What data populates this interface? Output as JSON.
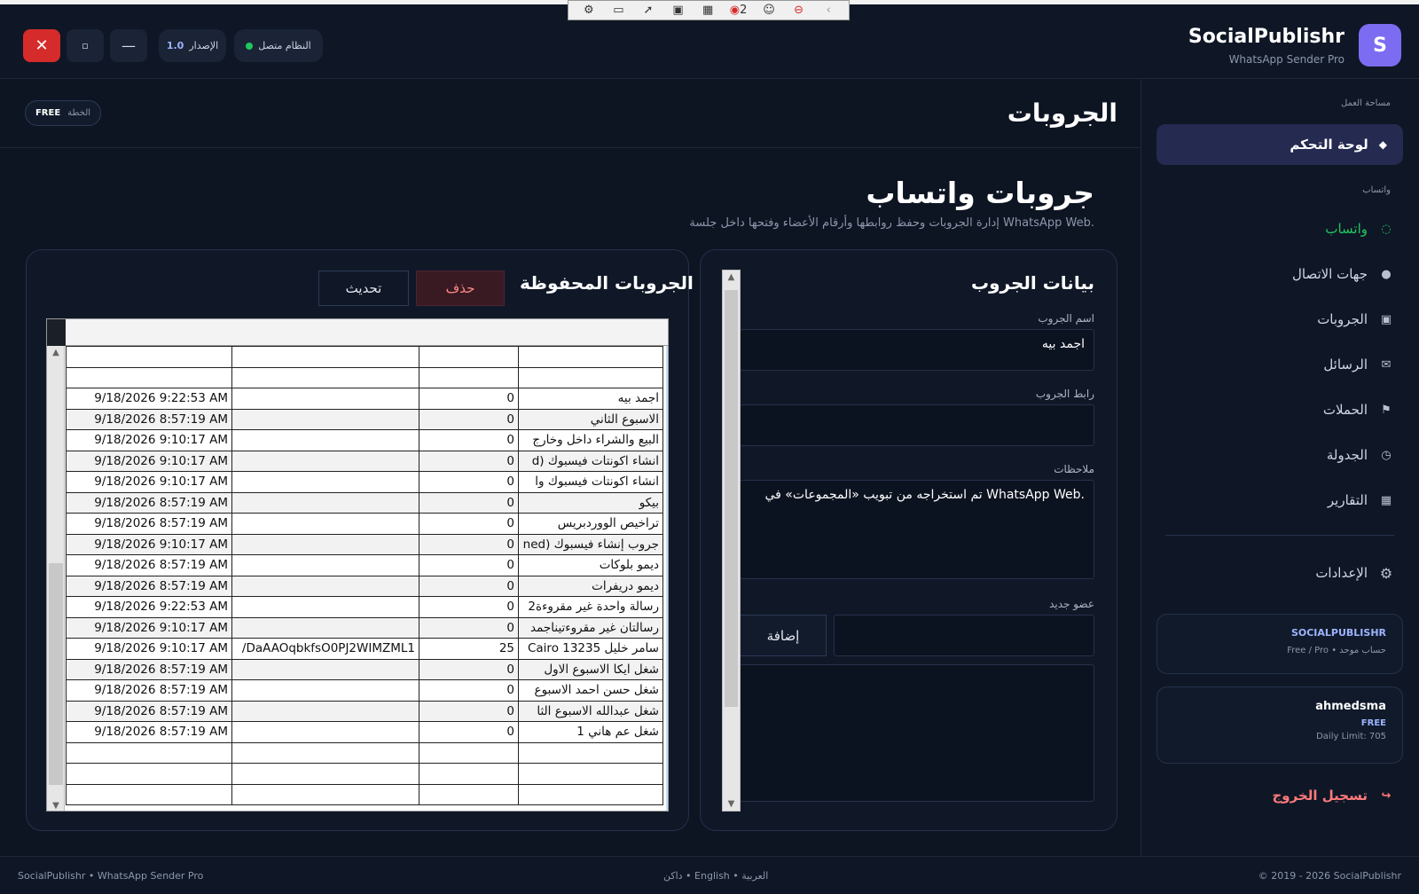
{
  "app": {
    "brand_title": "SocialPublishr",
    "brand_sub": "WhatsApp Sender Pro",
    "logo_letter": "S",
    "status_text": "النظام متصل",
    "version_label": "الإصدار",
    "version_value": "1.0",
    "plan_label": "الخطة",
    "plan_value": "FREE",
    "accent": "#7c6cf2",
    "whatsapp_green": "#22c55e",
    "danger": "#d62b2b"
  },
  "capture_toolbar": {
    "counter": "2"
  },
  "sidebar": {
    "section_workspace": "مساحة العمل",
    "dashboard": "لوحة التحكم",
    "section_whatsapp": "واتساب",
    "items": [
      {
        "label": "واتساب",
        "icon": "chat-bubble-icon"
      },
      {
        "label": "جهات الاتصال",
        "icon": "contacts-icon"
      },
      {
        "label": "الجروبات",
        "icon": "groups-icon"
      },
      {
        "label": "الرسائل",
        "icon": "envelope-icon"
      },
      {
        "label": "الحملات",
        "icon": "flag-icon"
      },
      {
        "label": "الجدولة",
        "icon": "clock-icon"
      },
      {
        "label": "التقارير",
        "icon": "report-icon"
      }
    ],
    "settings": "الإعدادات",
    "account_card": {
      "title": "SOCIALPUBLISHR",
      "sub": "Free / Pro • حساب موحد"
    },
    "user_card": {
      "name": "ahmedsma",
      "plan": "FREE",
      "limit": "Daily Limit: 705"
    },
    "logout": "تسجيل الخروج"
  },
  "header": {
    "title": "الجروبات"
  },
  "section": {
    "title": "جروبات واتساب",
    "subtitle": "إدارة الجروبات وحفظ روابطها وأرقام الأعضاء وفتحها داخل جلسة WhatsApp Web."
  },
  "form": {
    "title": "بيانات الجروب",
    "name_label": "اسم الجروب",
    "name_value": "اجمد بيه",
    "link_label": "رابط الجروب",
    "link_value": "",
    "notes_label": "ملاحظات",
    "notes_value": "تم استخراجه من تبويب «المجموعات» في WhatsApp Web.",
    "member_label": "عضو جديد",
    "member_value": "",
    "add_button": "إضافة"
  },
  "saved": {
    "title": "الجروبات المحفوظة",
    "delete_button": "حذف",
    "refresh_button": "تحديث",
    "rows": [
      {
        "name": "اجمد بيه",
        "members": "0",
        "link": "",
        "updated": "9/18/2026 9:22:53 AM"
      },
      {
        "name": "الاسبوع الثاني",
        "members": "0",
        "link": "",
        "updated": "9/18/2026 8:57:19 AM"
      },
      {
        "name": "البيع والشراء داخل وخارج",
        "members": "0",
        "link": "",
        "updated": "9/18/2026 9:10:17 AM"
      },
      {
        "name": "انشاء اكونتات فيسبوك (d",
        "members": "0",
        "link": "",
        "updated": "9/18/2026 9:10:17 AM"
      },
      {
        "name": "انشاء اكونتات فيسبوك وا",
        "members": "0",
        "link": "",
        "updated": "9/18/2026 9:10:17 AM"
      },
      {
        "name": "بيكو",
        "members": "0",
        "link": "",
        "updated": "9/18/2026 8:57:19 AM"
      },
      {
        "name": "تراخيص الووردبريس",
        "members": "0",
        "link": "",
        "updated": "9/18/2026 8:57:19 AM"
      },
      {
        "name": "جروب إنشاء فيسبوك (ned",
        "members": "0",
        "link": "",
        "updated": "9/18/2026 9:10:17 AM"
      },
      {
        "name": "ديمو بلوكات",
        "members": "0",
        "link": "",
        "updated": "9/18/2026 8:57:19 AM"
      },
      {
        "name": "ديمو دريفرات",
        "members": "0",
        "link": "",
        "updated": "9/18/2026 8:57:19 AM"
      },
      {
        "name": "رسالة واحدة غير مقروءة2",
        "members": "0",
        "link": "",
        "updated": "9/18/2026 9:22:53 AM"
      },
      {
        "name": "رسالتان غير مقروءتيناجمد",
        "members": "0",
        "link": "",
        "updated": "9/18/2026 9:10:17 AM"
      },
      {
        "name": "سامر خليل Cairo 13235",
        "members": "25",
        "link": "/DaAAOqbkfsO0PJ2WIMZML1",
        "updated": "9/18/2026 9:10:17 AM"
      },
      {
        "name": "شغل ايكا الاسبوع الاول",
        "members": "0",
        "link": "",
        "updated": "9/18/2026 8:57:19 AM"
      },
      {
        "name": "شغل حسن احمد الاسبوع",
        "members": "0",
        "link": "",
        "updated": "9/18/2026 8:57:19 AM"
      },
      {
        "name": "شغل عبدالله الاسبوع الثا",
        "members": "0",
        "link": "",
        "updated": "9/18/2026 8:57:19 AM"
      },
      {
        "name": "شغل عم هاني 1",
        "members": "0",
        "link": "",
        "updated": "9/18/2026 8:57:19 AM"
      }
    ]
  },
  "footer": {
    "left": "SocialPublishr • WhatsApp Sender Pro",
    "center": "العربية • English • داكن",
    "right": "© 2019 - 2026 SocialPublishr"
  }
}
